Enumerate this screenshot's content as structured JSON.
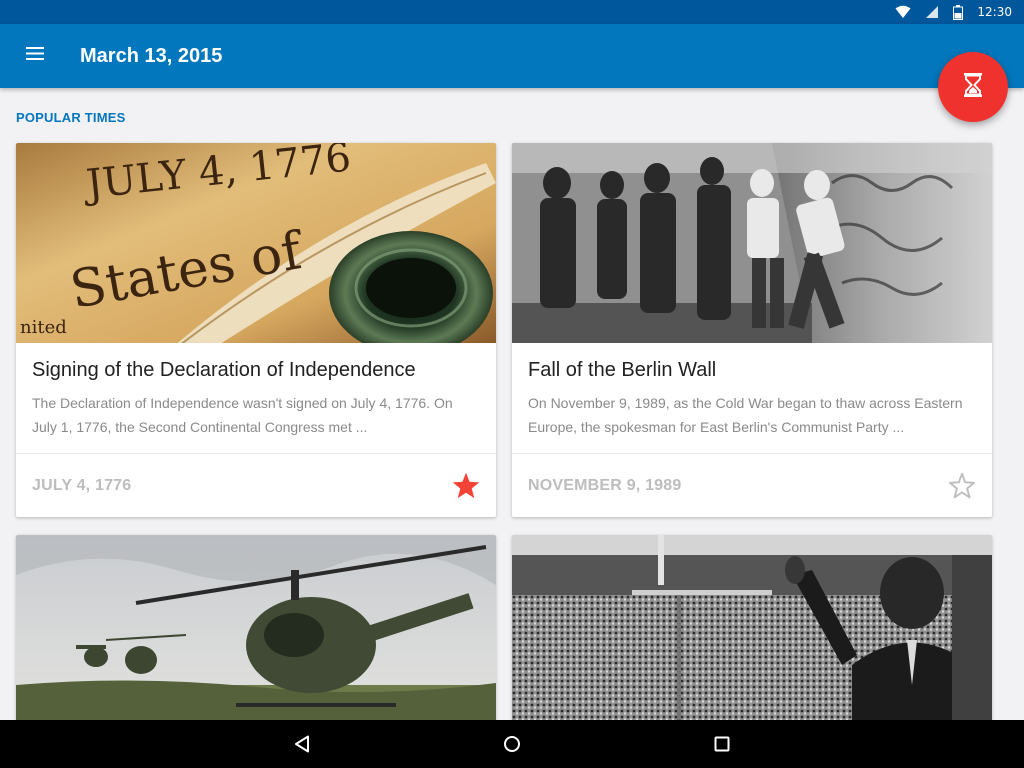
{
  "status_bar": {
    "time": "12:30"
  },
  "app_bar": {
    "title": "March 13, 2015"
  },
  "section": {
    "header": "POPULAR TIMES"
  },
  "cards": [
    {
      "title": "Signing of the Declaration of Independence",
      "description": "The Declaration of Independence wasn't signed on July 4, 1776. On July 1, 1776, the Second Continental Congress met ...",
      "date": "JULY 4, 1776",
      "favorite": true,
      "image_text": [
        "JULY 4, 1776",
        "States of",
        "nited"
      ]
    },
    {
      "title": "Fall of the Berlin Wall",
      "description": "On November 9, 1989, as the Cold War began to thaw across Eastern Europe, the spokesman for East Berlin's Communist Party ...",
      "date": "NOVEMBER 9, 1989",
      "favorite": false
    },
    {
      "image": "helicopters"
    },
    {
      "image": "crowd-speech"
    }
  ],
  "colors": {
    "primary": "#0277bd",
    "primary_dark": "#01579b",
    "accent": "#f0322e",
    "star_active": "#f44336"
  },
  "icons": [
    "menu-icon",
    "hourglass-icon",
    "star-filled-icon",
    "star-outline-icon",
    "wifi-icon",
    "signal-icon",
    "battery-icon",
    "back-icon",
    "home-icon",
    "recents-icon"
  ]
}
